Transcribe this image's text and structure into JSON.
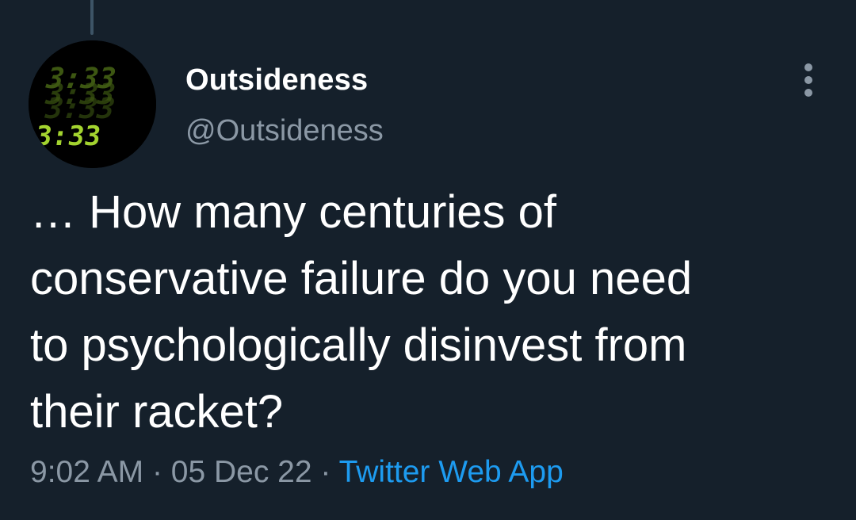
{
  "tweet": {
    "author": {
      "display_name": "Outsideness",
      "handle": "@Outsideness",
      "avatar_clock": "3:33"
    },
    "text_lines": [
      "… How many centuries of",
      "conservative failure do you need",
      "to psychologically disinvest from",
      "their racket?"
    ],
    "time": "9:02 AM",
    "date": "05 Dec 22",
    "separator": "·",
    "source": "Twitter Web App"
  },
  "icons": {
    "more": "more-vertical-icon"
  },
  "colors": {
    "background": "#15202b",
    "text_primary": "#ffffff",
    "text_secondary": "#8b98a5",
    "accent": "#1d9bf0",
    "avatar_digits": "#a3d32f"
  }
}
